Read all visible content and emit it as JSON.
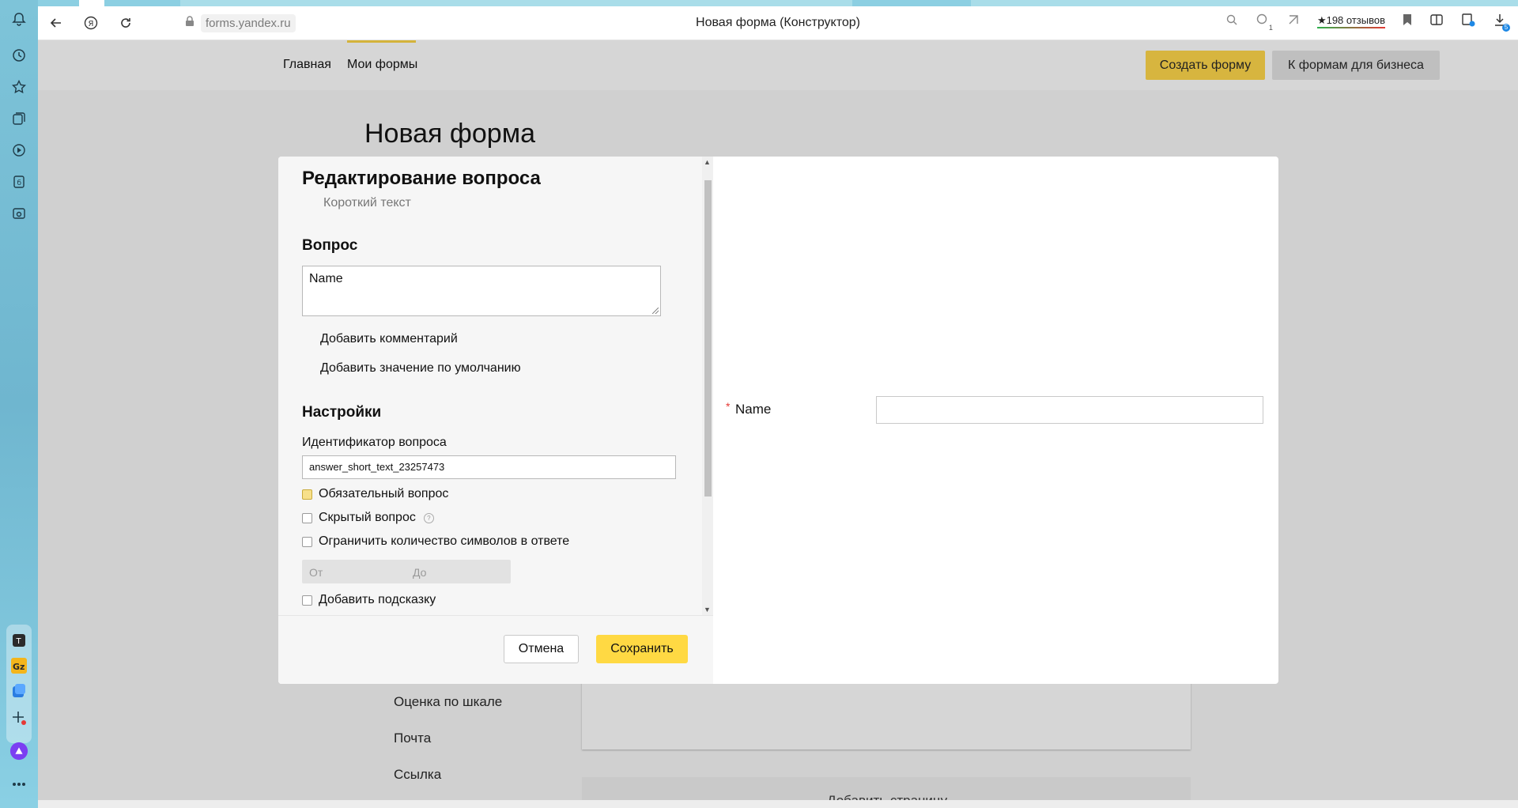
{
  "browser": {
    "url": "forms.yandex.ru",
    "tab_title": "Новая форма (Конструктор)",
    "reviews": "★198 отзывов",
    "downloads_badge": "5",
    "tab_badge": "1"
  },
  "header": {
    "nav": [
      "Главная",
      "Мои формы"
    ],
    "create_button": "Создать форму",
    "business_button": "К формам для бизнеса"
  },
  "page": {
    "title": "Новая форма",
    "list_items": [
      "Оценка по шкале",
      "Почта",
      "Ссылка"
    ],
    "add_page": "Добавить страницу"
  },
  "modal": {
    "heading": "Редактирование вопроса",
    "question_type": "Короткий текст",
    "question_section": "Вопрос",
    "question_value": "Name",
    "add_comment": "Добавить комментарий",
    "add_default": "Добавить значение по умолчанию",
    "settings_section": "Настройки",
    "id_label": "Идентификатор вопроса",
    "id_value": "answer_short_text_23257473",
    "required_label": "Обязательный вопрос",
    "hidden_label": "Скрытый вопрос",
    "limit_label": "Ограничить количество символов в ответе",
    "range_from_placeholder": "От",
    "range_to_placeholder": "До",
    "hint_label": "Добавить подсказку",
    "cancel_button": "Отмена",
    "save_button": "Сохранить"
  },
  "preview": {
    "required_mark": "*",
    "label": "Name"
  },
  "colors": {
    "accent_yellow": "#ffd943",
    "header_button": "#d7b53f",
    "required": "#e53935"
  }
}
